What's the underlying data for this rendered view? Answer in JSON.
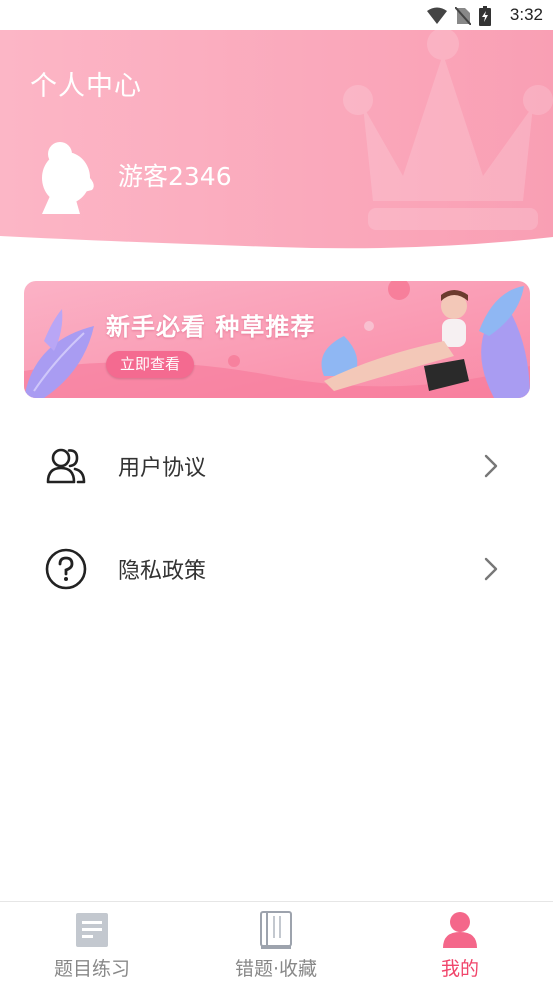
{
  "status_bar": {
    "time": "3:32"
  },
  "header": {
    "title": "个人中心",
    "username": "游客2346"
  },
  "banner": {
    "title": "新手必看 种草推荐",
    "button_label": "立即查看"
  },
  "menu": [
    {
      "label": "用户协议",
      "icon": "users-icon"
    },
    {
      "label": "隐私政策",
      "icon": "question-icon"
    }
  ],
  "tabbar": {
    "tabs": [
      {
        "label": "题目练习",
        "icon": "document-icon",
        "active": false
      },
      {
        "label": "错题·收藏",
        "icon": "book-icon",
        "active": false
      },
      {
        "label": "我的",
        "icon": "person-icon",
        "active": true
      }
    ]
  },
  "colors": {
    "header_pink": "#fca6b9",
    "accent": "#f0466b",
    "button_pink": "#f46a90"
  }
}
